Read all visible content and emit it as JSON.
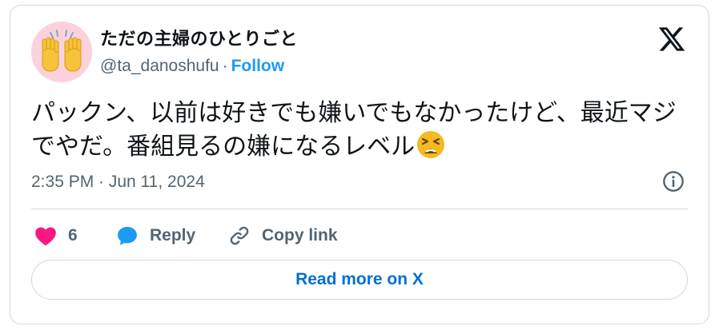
{
  "author": {
    "display_name": "ただの主婦のひとりごと",
    "handle": "@ta_danoshufu",
    "separator": "·",
    "follow_label": "Follow",
    "avatar_icon": "raising-hands-emoji-icon"
  },
  "tweet": {
    "text": "パックン、以前は好きでも嫌いでもなかったけど、最近マジでやだ。番組見るの嫌になるレベル",
    "emoji_icon": "tired-face-emoji-icon",
    "timestamp": "2:35 PM · Jun 11, 2024"
  },
  "actions": {
    "like_count": "6",
    "reply_label": "Reply",
    "copy_link_label": "Copy link"
  },
  "read_more_label": "Read more on X",
  "colors": {
    "accent": "#1d9bf0",
    "like": "#f91880",
    "read_more": "#006fd6",
    "border": "#cfd9de",
    "muted": "#536471"
  }
}
